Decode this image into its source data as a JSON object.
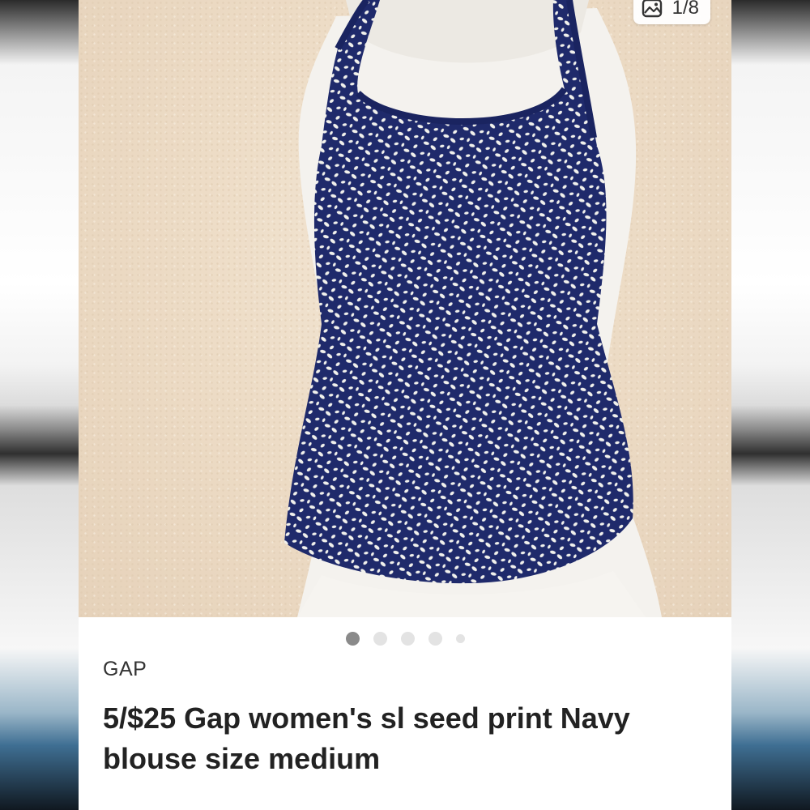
{
  "listing": {
    "image_counter": "1/8",
    "counter_icon": "image-gallery-icon",
    "carousel": {
      "dot_count": 5,
      "active_index": 0
    },
    "brand": "GAP",
    "title": "5/$25 Gap women's sl seed print Navy blouse size medium"
  },
  "colors": {
    "garment": "#1f2a6b",
    "print": "#f1f1ec",
    "wall": "#eddcc6",
    "mannequin": "#f4f2ee",
    "text": "#222222",
    "active_dot": "#8a8a8a",
    "inactive_dot": "#e3e3e3"
  }
}
